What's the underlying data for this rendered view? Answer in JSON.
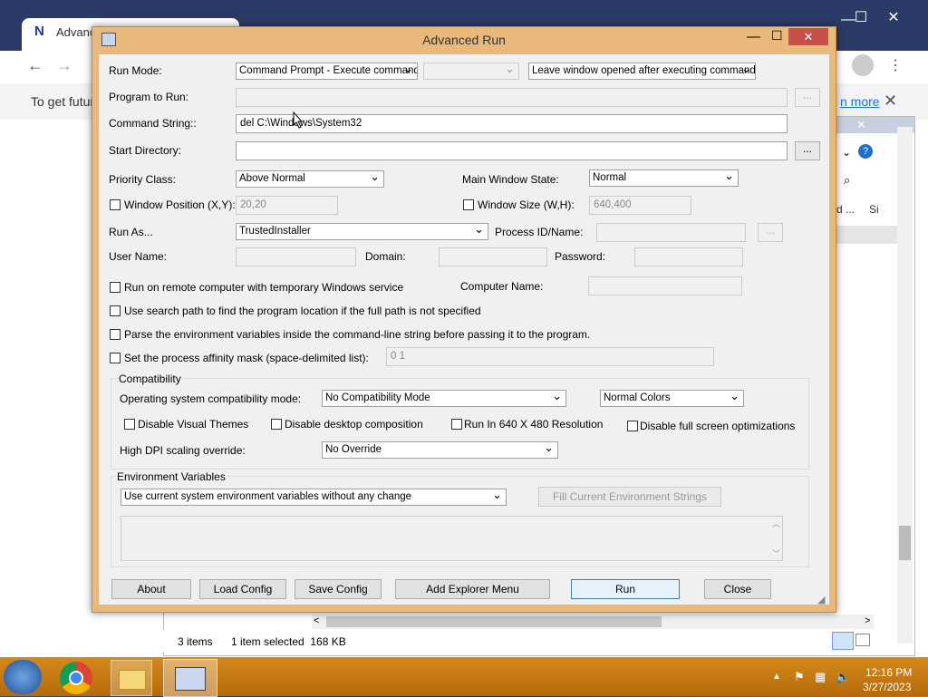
{
  "browser": {
    "tab_title": "Advanc",
    "infobar_text": "To get futur",
    "learn_more": "n more"
  },
  "explorer": {
    "status_items": "3 items",
    "status_selected": "1 item selected  168 KB",
    "col_partial_1": "d ...",
    "col_partial_2": "Si"
  },
  "dialog": {
    "title": "Advanced Run",
    "run_mode_label": "Run Mode:",
    "run_mode_value": "Command Prompt - Execute command",
    "window_option_value": "Leave window opened after executing command",
    "program_to_run_label": "Program to Run:",
    "program_to_run_value": "",
    "command_string_label": "Command String::",
    "command_string_value": "del C:\\Windows\\System32",
    "start_directory_label": "Start Directory:",
    "start_directory_value": "",
    "priority_class_label": "Priority Class:",
    "priority_class_value": "Above Normal",
    "main_window_state_label": "Main Window State:",
    "main_window_state_value": "Normal",
    "window_position_label": "Window Position (X,Y):",
    "window_position_value": "20,20",
    "window_size_label": "Window Size (W,H):",
    "window_size_value": "640,400",
    "run_as_label": "Run As...",
    "run_as_value": "TrustedInstaller",
    "process_id_label": "Process ID/Name:",
    "user_name_label": "User Name:",
    "domain_label": "Domain:",
    "password_label": "Password:",
    "remote_label": "Run on remote computer with temporary Windows service",
    "computer_name_label": "Computer Name:",
    "search_path_label": "Use search path to find the program location if the full path is not specified",
    "parse_env_label": "Parse the environment variables inside the command-line string before passing it to the program.",
    "affinity_label": "Set the process affinity mask (space-delimited list):",
    "affinity_value": "0 1",
    "compat_group_label": "Compatibility",
    "os_compat_label": "Operating system compatibility mode:",
    "os_compat_value": "No Compatibility Mode",
    "colors_value": "Normal Colors",
    "disable_themes_label": "Disable Visual Themes",
    "disable_desktop_label": "Disable desktop composition",
    "run_640_label": "Run In 640 X 480 Resolution",
    "disable_fullscreen_label": "Disable full screen optimizations",
    "dpi_label": "High DPI scaling override:",
    "dpi_value": "No Override",
    "env_group_label": "Environment Variables",
    "env_value": "Use current system environment variables without any change",
    "fill_env_button": "Fill Current Environment Strings",
    "browse_label": "...",
    "buttons": {
      "about": "About",
      "load_config": "Load Config",
      "save_config": "Save Config",
      "add_explorer_menu": "Add Explorer Menu",
      "run": "Run",
      "close": "Close"
    }
  },
  "taskbar": {
    "time": "12:16 PM",
    "date": "3/27/2023"
  }
}
